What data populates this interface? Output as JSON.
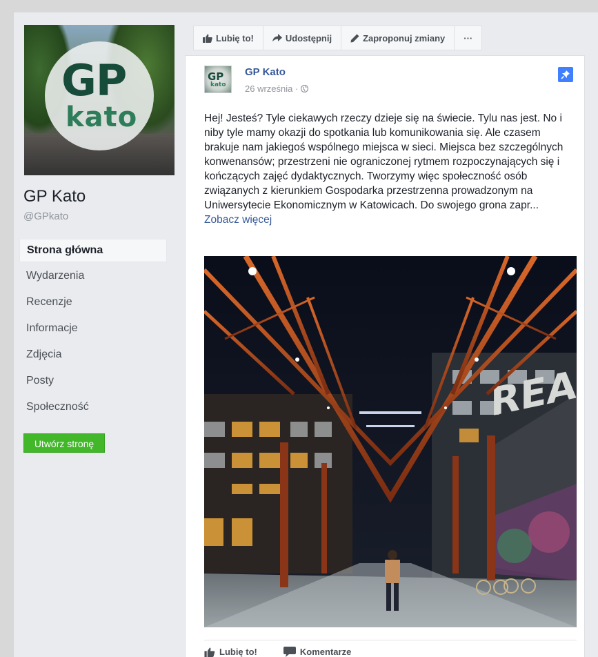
{
  "page": {
    "name": "GP Kato",
    "handle": "@GPkato",
    "cover_logo": {
      "top": "GP",
      "bottom": "kato"
    }
  },
  "sidebar": {
    "items": [
      {
        "label": "Strona główna",
        "active": true
      },
      {
        "label": "Wydarzenia"
      },
      {
        "label": "Recenzje"
      },
      {
        "label": "Informacje"
      },
      {
        "label": "Zdjęcia"
      },
      {
        "label": "Posty"
      },
      {
        "label": "Społeczność"
      }
    ],
    "create_button": "Utwórz stronę"
  },
  "toolbar": {
    "like": "Lubię to!",
    "share": "Udostępnij",
    "suggest": "Zaproponuj zmiany",
    "more": "···"
  },
  "post": {
    "author": "GP Kato",
    "date": "26 września",
    "separator": "·",
    "text": "Hej! Jesteś? Tyle ciekawych rzeczy dzieje się na świecie. Tylu nas jest. No i niby tyle mamy okazji do spotkania lub komunikowania się. Ale czasem brakuje nam jakiegoś wspólnego miejsca w sieci. Miejsca bez szczególnych konwenansów; przestrzeni nie ograniczonej rytmem rozpoczynających się i kończących zajęć dydaktycznych. Tworzymy więc społeczność osób związanych z kierunkiem Gospodarka przestrzenna prowadzonym na Uniwersytecie Ekonomicznym w Katowicach. Do swojego grona zapr...",
    "see_more": "Zobacz więcej",
    "photo_wall_text": "REAG T"
  },
  "post_actions": {
    "like": "Lubię to!",
    "comments": "Komentarze"
  },
  "colors": {
    "link": "#365899",
    "create_button": "#42b72a",
    "pin": "#4080ff",
    "background": "#e9ebee"
  },
  "icons": [
    "thumbs-up-icon",
    "share-arrow-icon",
    "pencil-icon",
    "more-icon",
    "pin-icon",
    "globe-icon",
    "comment-icon"
  ]
}
